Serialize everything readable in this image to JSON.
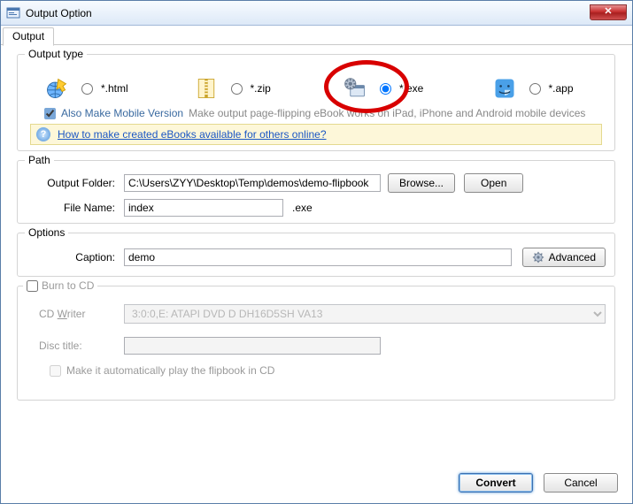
{
  "window": {
    "title": "Output Option"
  },
  "tabs": {
    "output": "Output"
  },
  "output_type": {
    "legend": "Output type",
    "html": "*.html",
    "zip": "*.zip",
    "exe": "*.exe",
    "app": "*.app",
    "selected": "exe",
    "mobile_checked": true,
    "mobile_label": "Also Make Mobile Version",
    "mobile_hint": "Make output page-flipping eBook works on iPad, iPhone and Android mobile devices",
    "info_link": "How to make created eBooks available for others online?"
  },
  "path": {
    "legend": "Path",
    "folder_label": "Output Folder:",
    "folder_value": "C:\\Users\\ZYY\\Desktop\\Temp\\demos\\demo-flipbook",
    "browse": "Browse...",
    "open": "Open",
    "filename_label": "File Name:",
    "filename_value": "index",
    "ext": ".exe"
  },
  "options": {
    "legend": "Options",
    "caption_label": "Caption:",
    "caption_value": "demo",
    "advanced": "Advanced"
  },
  "burn": {
    "legend": "Burn to CD",
    "checked": false,
    "writer_label": "CD Writer",
    "writer_value": "3:0:0,E: ATAPI   DVD D  DH16D5SH  VA13",
    "disc_label": "Disc title:",
    "disc_value": "",
    "auto_label": "Make it automatically play the flipbook in CD",
    "auto_checked": false
  },
  "footer": {
    "convert": "Convert",
    "cancel": "Cancel"
  }
}
